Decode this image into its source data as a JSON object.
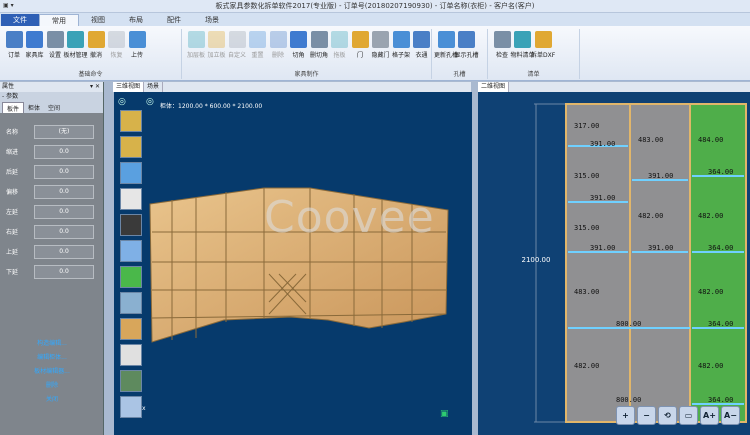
{
  "window": {
    "title": "板式家具参数化拆单软件2017(专业版) - 订单号(20180207190930) - 订单名称(衣柜) - 客户名(客户)"
  },
  "tabs": [
    "文件",
    "常用",
    "视图",
    "布局",
    "配件",
    "场景"
  ],
  "ribbon": {
    "groups": [
      {
        "caption": "基础命令",
        "buttons": [
          "订单",
          "家具库",
          "设置",
          "板材管理",
          "撤消",
          "恢复",
          "上传"
        ],
        "disabled": [
          false,
          false,
          false,
          false,
          false,
          true,
          false
        ]
      },
      {
        "caption": "家具制作",
        "buttons": [
          "加层板",
          "加立板",
          "自定义",
          "重置",
          "删除",
          "切角",
          "删切角",
          "拖板",
          "门",
          "隐藏门",
          "格子架",
          "衣通"
        ],
        "disabled": [
          true,
          true,
          true,
          true,
          true,
          false,
          false,
          true,
          false,
          false,
          false,
          false
        ]
      },
      {
        "caption": "孔槽",
        "buttons": [
          "更新孔槽",
          "显示孔槽"
        ],
        "disabled": [
          false,
          false
        ]
      },
      {
        "caption": "清单",
        "buttons": [
          "检查",
          "物料清单",
          "拆单DXF"
        ],
        "disabled": [
          false,
          false,
          false
        ]
      }
    ]
  },
  "left_panel": {
    "header": "属性",
    "sub_header": "参数",
    "tabs": [
      "板件",
      "柜体",
      "空间"
    ],
    "properties": [
      {
        "key": "名称",
        "value": "(无)"
      },
      {
        "key": "缩进",
        "value": "0.0"
      },
      {
        "key": "后延",
        "value": "0.0"
      },
      {
        "key": "偏移",
        "value": "0.0"
      },
      {
        "key": "左延",
        "value": "0.0"
      },
      {
        "key": "右延",
        "value": "0.0"
      },
      {
        "key": "上延",
        "value": "0.0"
      },
      {
        "key": "下延",
        "value": "0.0"
      }
    ],
    "links": [
      "构造编辑...",
      "编辑柜体...",
      "板材编辑器...",
      "删除",
      "关闭"
    ]
  },
  "view3d": {
    "tabs": [
      "三维视图",
      "场景"
    ],
    "dims": "柜体：1200.00 * 600.00 * 2100.00",
    "watermark": "Coovee"
  },
  "view2d": {
    "tabs": [
      "二维视图"
    ],
    "height_label": "2100.00",
    "col1": [
      "317.00",
      "391.00",
      "315.00",
      "391.00",
      "315.00",
      "391.00",
      "483.00",
      "800.00",
      "482.00",
      "800.00"
    ],
    "col2": [
      "483.00",
      "391.00",
      "482.00",
      "391.00"
    ],
    "col3": [
      "484.00",
      "364.00",
      "482.00",
      "364.00",
      "482.00",
      "364.00",
      "482.00",
      "364.00"
    ],
    "zoom_buttons": [
      "+",
      "−",
      "⟲",
      "▭",
      "A+",
      "A−"
    ]
  },
  "colors": {
    "accent": "#2e5fb5",
    "canvas3d": "#063a6c",
    "green": "#4fae4a",
    "panel": "#7f858c",
    "link": "#31a9ff"
  }
}
